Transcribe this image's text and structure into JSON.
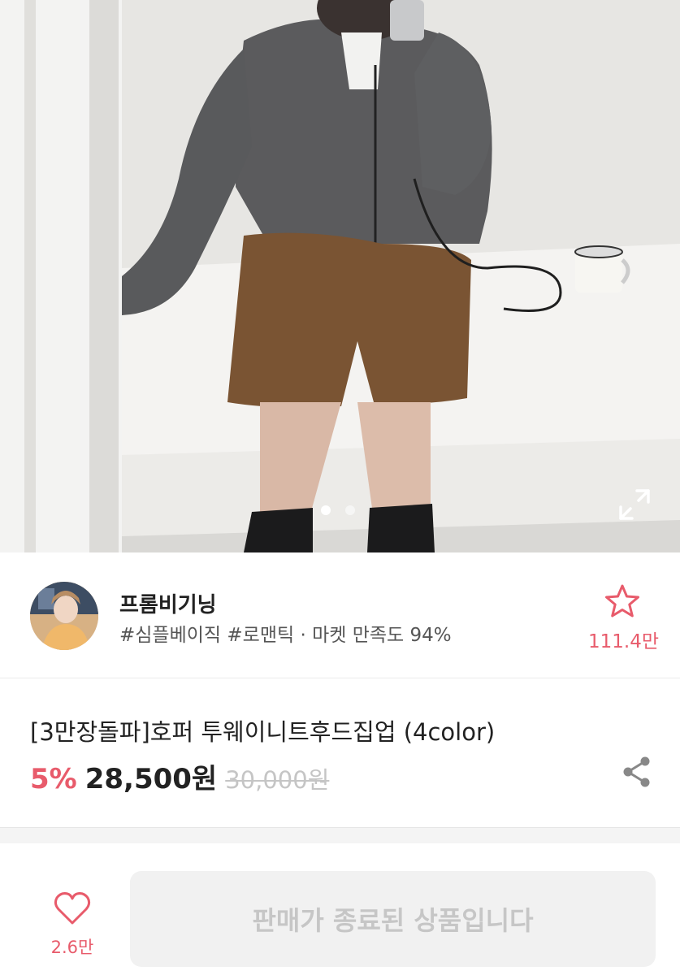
{
  "gallery": {
    "image_alt": "Product photo",
    "slide_count": 2,
    "active_slide": 1,
    "icons": {
      "expand": "expand-icon"
    }
  },
  "shop": {
    "name": "프롬비기닝",
    "tags": "#심플베이직 #로맨틱 · 마켓 만족도 94%",
    "favorite_count": "111.4만",
    "icons": {
      "favorite": "star-outline-icon",
      "avatar": "avatar"
    }
  },
  "product": {
    "title": "[3만장돌파]호퍼 투웨이니트후드집업 (4color)",
    "discount": "5%",
    "price": "28,500원",
    "original_price": "30,000원",
    "icons": {
      "share": "share-icon"
    }
  },
  "bottom_bar": {
    "like_count": "2.6만",
    "status_button": "판매가 종료된 상품입니다",
    "icons": {
      "like": "heart-outline-icon"
    }
  },
  "colors": {
    "accent": "#e85b6b",
    "disabled_bg": "#f1f1f1",
    "disabled_text": "#c6c6c6"
  }
}
